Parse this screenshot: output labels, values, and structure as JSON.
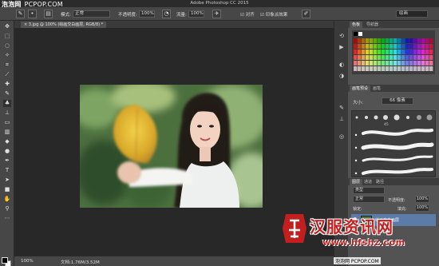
{
  "app": {
    "window_title": "Adobe Photoshop CC 2015",
    "watermark_brand": "泡泡网",
    "watermark_site": "PCPOP.COM",
    "workspace": "绘画"
  },
  "options_bar": {
    "mode_label": "模式:",
    "mode_value": "正常",
    "opacity_label": "不透明度:",
    "opacity_value": "100%",
    "flow_label": "流量:",
    "flow_value": "100%",
    "align_label": "对齐",
    "sample_label": "印象派效果"
  },
  "document": {
    "tab_label": "3.jpg @ 100% (绘画交白画层, RGB/8) *"
  },
  "status": {
    "zoom": "100%",
    "doc_size": "文档:1.76M/3.52M"
  },
  "panels": {
    "color_tabs": [
      "色板",
      "导航器"
    ],
    "brush_tabs": [
      "画笔预设",
      "画笔"
    ],
    "brush_size_label": "大小:",
    "brush_size_value": "66 像素",
    "brush_tip_sizes": [
      "",
      "",
      "",
      "45",
      "",
      "",
      "",
      ""
    ],
    "layers_tabs": [
      "图层",
      "通道",
      "路径"
    ],
    "layer_filter": "类型",
    "blend_mode": "正常",
    "opacity_label": "不透明度:",
    "opacity_value": "100%",
    "lock_label": "锁定:",
    "fill_label": "填充:",
    "fill_value": "100%",
    "layers": [
      {
        "name": "绘画交白画层",
        "selected": true
      }
    ]
  },
  "watermark": {
    "text": "汉服资讯网",
    "url": "www.hfshz.com",
    "credit": "泡泡网 PCPOP.COM"
  },
  "colors": {
    "chrome_dark": "#2b2b2b",
    "panel": "#535353",
    "selection": "#5c7ba6",
    "watermark_red": "#c41f1f"
  }
}
